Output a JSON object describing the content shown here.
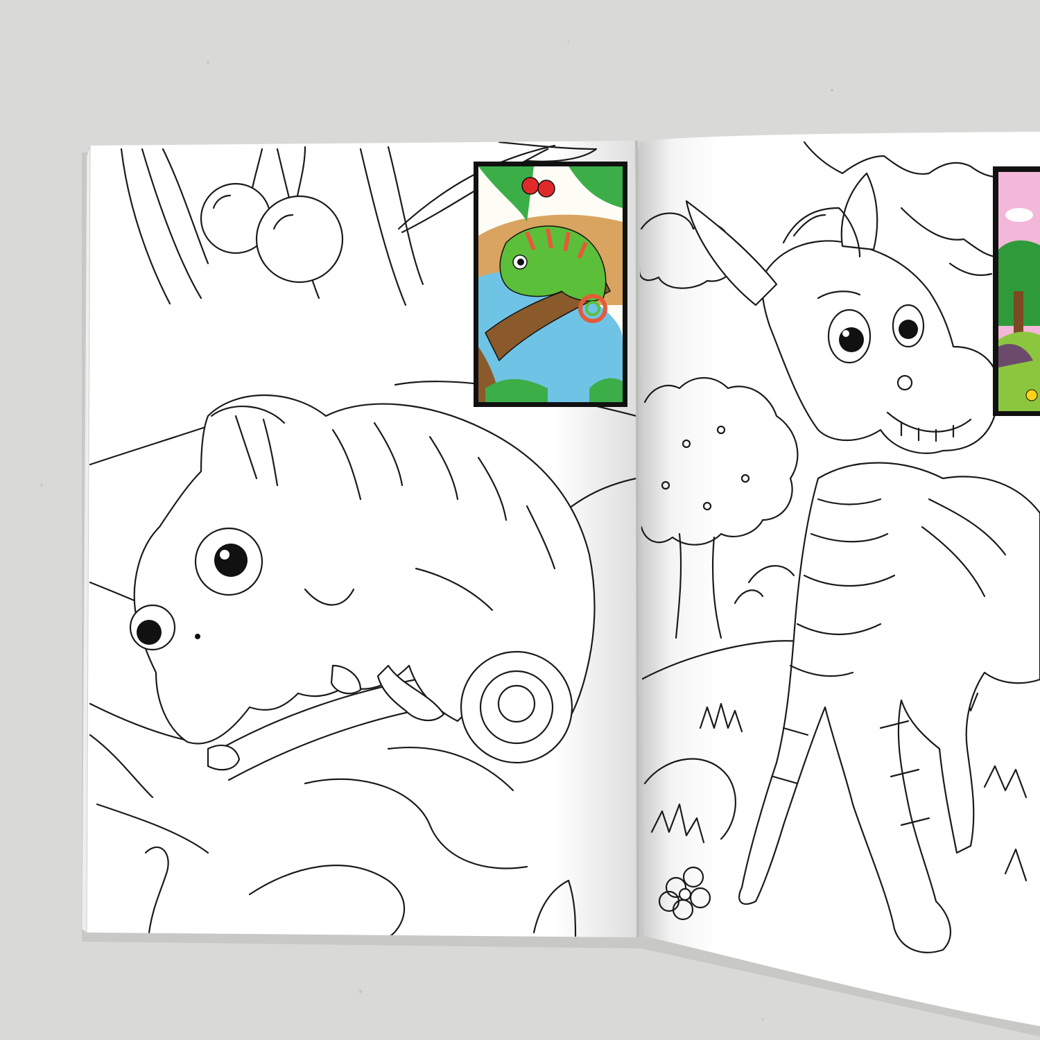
{
  "scene": {
    "description_colors": {
      "surface": "#d9d9d7",
      "paper": "#ffffff",
      "ink": "#1a1a1a",
      "gutter_shadow": "#bdbdbd"
    }
  },
  "left_page": {
    "subject": "chameleon",
    "reference_card": {
      "sky": "#fdfdf5",
      "ground": "#d9a460",
      "water": "#6fc4e6",
      "leaf": "#3cae48",
      "chameleon_body": "#5cbf3a",
      "chameleon_stripe": "#e45a3a",
      "branch": "#8a5a2b",
      "berry": "#e02a2a"
    }
  },
  "right_page": {
    "subject": "zebra",
    "reference_card": {
      "sky": "#f3b7d9",
      "cloud": "#ffffff",
      "tree": "#2f9a3a",
      "trunk": "#7c4a22",
      "grass": "#8cc63f",
      "rock": "#6b4a6b",
      "flower": "#ffd21a"
    }
  }
}
